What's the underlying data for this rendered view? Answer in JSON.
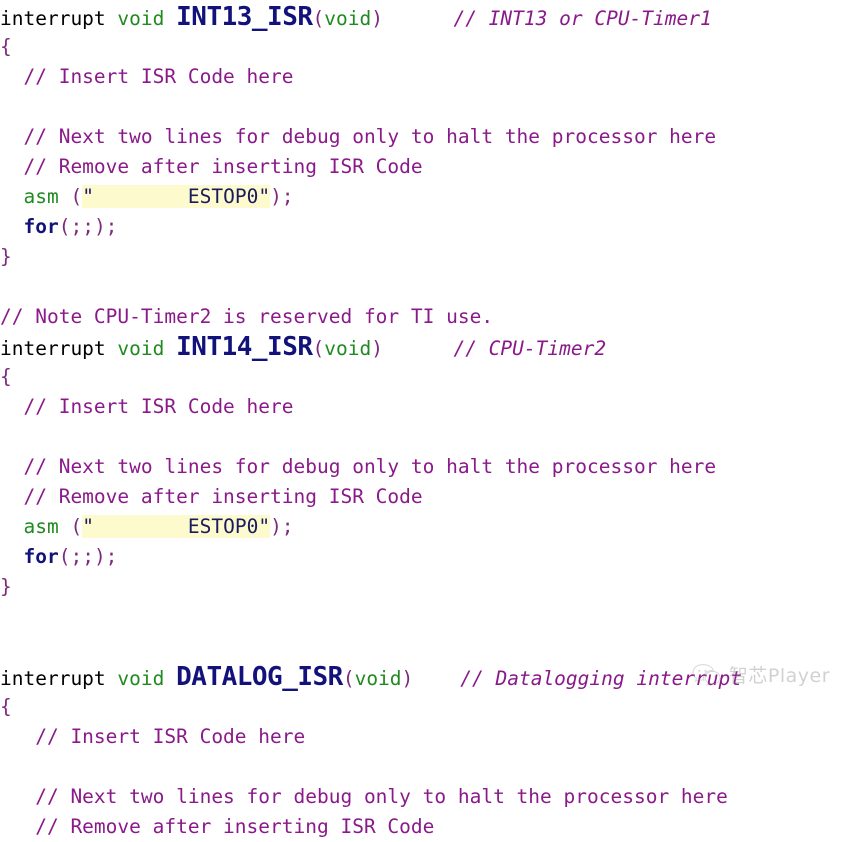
{
  "document": {
    "type": "c-source-code",
    "language": "C",
    "background_color": "#ffffff"
  },
  "colors": {
    "keyword_black": "#000000",
    "type_green": "#1f8a1f",
    "function_navy": "#12127a",
    "punctuation_purple": "#7d2a7d",
    "comment_purple": "#8a1a8a",
    "string_text": "#1a1a5e",
    "string_highlight_bg": "#fdfbcd",
    "watermark_gray": "#8f8f8f"
  },
  "code": {
    "lines": [
      {
        "id": "int13-signature",
        "tokens": [
          {
            "t": "interrupt",
            "c": "kw-black"
          },
          {
            "t": " ",
            "c": "kw-black"
          },
          {
            "t": "void",
            "c": "kw-void"
          },
          {
            "t": " ",
            "c": "kw-black"
          },
          {
            "t": "INT13_ISR",
            "c": "fname"
          },
          {
            "t": "(",
            "c": "punc"
          },
          {
            "t": "void",
            "c": "kw-void"
          },
          {
            "t": ")",
            "c": "punc"
          },
          {
            "t": "      ",
            "c": "kw-black"
          },
          {
            "t": "// INT13 or CPU-Timer1",
            "c": "comment-it"
          }
        ]
      },
      {
        "id": "int13-open-brace",
        "tokens": [
          {
            "t": "{",
            "c": "brace"
          }
        ]
      },
      {
        "id": "int13-insert-comment",
        "tokens": [
          {
            "t": "  // Insert ISR Code here",
            "c": "comment"
          }
        ]
      },
      {
        "id": "blank-1",
        "tokens": [
          {
            "t": " ",
            "c": "kw-black"
          }
        ]
      },
      {
        "id": "int13-debug-comment-1",
        "tokens": [
          {
            "t": "  // Next two lines for debug only to halt the processor here",
            "c": "comment"
          }
        ]
      },
      {
        "id": "int13-debug-comment-2",
        "tokens": [
          {
            "t": "  // Remove after inserting ISR Code",
            "c": "comment"
          }
        ]
      },
      {
        "id": "int13-asm-estop",
        "tokens": [
          {
            "t": "  ",
            "c": "kw-black"
          },
          {
            "t": "asm",
            "c": "kw-asm"
          },
          {
            "t": " ",
            "c": "kw-black"
          },
          {
            "t": "(",
            "c": "punc"
          },
          {
            "t": "\"        ESTOP0\"",
            "c": "str-hl"
          },
          {
            "t": ");",
            "c": "punc"
          }
        ]
      },
      {
        "id": "int13-for-loop",
        "tokens": [
          {
            "t": "  ",
            "c": "kw-black"
          },
          {
            "t": "for",
            "c": "kw-for"
          },
          {
            "t": "(;;);",
            "c": "punc"
          }
        ]
      },
      {
        "id": "int13-close-brace",
        "tokens": [
          {
            "t": "}",
            "c": "brace"
          }
        ]
      },
      {
        "id": "blank-2",
        "tokens": [
          {
            "t": " ",
            "c": "kw-black"
          }
        ]
      },
      {
        "id": "note-timer2-comment",
        "tokens": [
          {
            "t": "// Note CPU-Timer2 is reserved for TI use.",
            "c": "comment"
          }
        ]
      },
      {
        "id": "int14-signature",
        "tokens": [
          {
            "t": "interrupt",
            "c": "kw-black"
          },
          {
            "t": " ",
            "c": "kw-black"
          },
          {
            "t": "void",
            "c": "kw-void"
          },
          {
            "t": " ",
            "c": "kw-black"
          },
          {
            "t": "INT14_ISR",
            "c": "fname"
          },
          {
            "t": "(",
            "c": "punc"
          },
          {
            "t": "void",
            "c": "kw-void"
          },
          {
            "t": ")",
            "c": "punc"
          },
          {
            "t": "      ",
            "c": "kw-black"
          },
          {
            "t": "// CPU-Timer2",
            "c": "comment-it"
          }
        ]
      },
      {
        "id": "int14-open-brace",
        "tokens": [
          {
            "t": "{",
            "c": "brace"
          }
        ]
      },
      {
        "id": "int14-insert-comment",
        "tokens": [
          {
            "t": "  // Insert ISR Code here",
            "c": "comment"
          }
        ]
      },
      {
        "id": "blank-3",
        "tokens": [
          {
            "t": " ",
            "c": "kw-black"
          }
        ]
      },
      {
        "id": "int14-debug-comment-1",
        "tokens": [
          {
            "t": "  // Next two lines for debug only to halt the processor here",
            "c": "comment"
          }
        ]
      },
      {
        "id": "int14-debug-comment-2",
        "tokens": [
          {
            "t": "  // Remove after inserting ISR Code",
            "c": "comment"
          }
        ]
      },
      {
        "id": "int14-asm-estop",
        "tokens": [
          {
            "t": "  ",
            "c": "kw-black"
          },
          {
            "t": "asm",
            "c": "kw-asm"
          },
          {
            "t": " ",
            "c": "kw-black"
          },
          {
            "t": "(",
            "c": "punc"
          },
          {
            "t": "\"        ESTOP0\"",
            "c": "str-hl"
          },
          {
            "t": ");",
            "c": "punc"
          }
        ]
      },
      {
        "id": "int14-for-loop",
        "tokens": [
          {
            "t": "  ",
            "c": "kw-black"
          },
          {
            "t": "for",
            "c": "kw-for"
          },
          {
            "t": "(;;);",
            "c": "punc"
          }
        ]
      },
      {
        "id": "int14-close-brace",
        "tokens": [
          {
            "t": "}",
            "c": "brace"
          }
        ]
      },
      {
        "id": "blank-4",
        "tokens": [
          {
            "t": " ",
            "c": "kw-black"
          }
        ]
      },
      {
        "id": "blank-5",
        "tokens": [
          {
            "t": " ",
            "c": "kw-black"
          }
        ]
      },
      {
        "id": "datalog-signature",
        "tokens": [
          {
            "t": "interrupt",
            "c": "kw-black"
          },
          {
            "t": " ",
            "c": "kw-black"
          },
          {
            "t": "void",
            "c": "kw-void"
          },
          {
            "t": " ",
            "c": "kw-black"
          },
          {
            "t": "DATALOG_ISR",
            "c": "fname"
          },
          {
            "t": "(",
            "c": "punc"
          },
          {
            "t": "void",
            "c": "kw-void"
          },
          {
            "t": ")",
            "c": "punc"
          },
          {
            "t": "    ",
            "c": "kw-black"
          },
          {
            "t": "// Datalogging interrupt",
            "c": "comment-it"
          }
        ]
      },
      {
        "id": "datalog-open-brace",
        "tokens": [
          {
            "t": "{",
            "c": "brace"
          }
        ]
      },
      {
        "id": "datalog-insert-comment",
        "tokens": [
          {
            "t": "   // Insert ISR Code here",
            "c": "comment"
          }
        ]
      },
      {
        "id": "blank-6",
        "tokens": [
          {
            "t": " ",
            "c": "kw-black"
          }
        ]
      },
      {
        "id": "datalog-debug-comment-1",
        "tokens": [
          {
            "t": "   // Next two lines for debug only to halt the processor here",
            "c": "comment"
          }
        ]
      },
      {
        "id": "datalog-debug-comment-2",
        "tokens": [
          {
            "t": "   // Remove after inserting ISR Code",
            "c": "comment"
          }
        ]
      }
    ]
  },
  "watermark": {
    "icon": "wechat-icon",
    "label": "智芯Player"
  }
}
